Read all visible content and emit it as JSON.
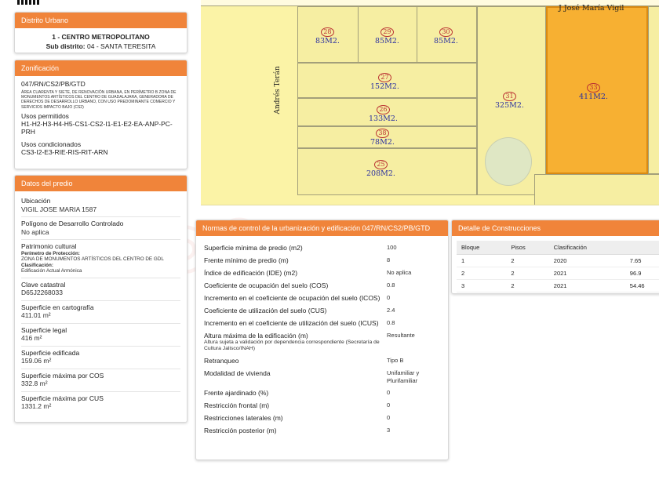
{
  "distrito": {
    "header": "Distrito Urbano",
    "name": "1 - CENTRO METROPOLITANO",
    "sub_label": "Sub distrito:",
    "sub_value": "04 - SANTA TERESITA"
  },
  "zonificacion": {
    "header": "Zonificación",
    "code": "047/RN/CS2/PB/GTD",
    "description": "ÁREA CUARENTA Y SIETE, DE RENOVACIÓN URBANA, EN PERÍMETRO B ZONA DE MONUMENTOS ARTÍSTICOS DEL CENTRO DE GUADALAJARA, GENERADORA DE DERECHOS DE DESARROLLO URBANO, CON USO PREDOMINANTE COMERCIO Y SERVICIOS IMPACTO BAJO (CS2)",
    "usos_permitidos_label": "Usos permitidos",
    "usos_permitidos": "H1-H2-H3-H4-H5-CS1-CS2-I1-E1-E2-EA-ANP-PC-PRH",
    "usos_condicionados_label": "Usos condicionados",
    "usos_condicionados": "CS3-I2-E3-RIE-RIS-RIT-ARN"
  },
  "predio": {
    "header": "Datos del predio",
    "ubicacion_label": "Ubicación",
    "ubicacion": "VIGIL JOSE MARIA 1587",
    "poligono_label": "Polígono de Desarrollo Controlado",
    "poligono": "No aplica",
    "patrimonio_label": "Patrimonio cultural",
    "perimetro_label": "Perímetro de Protección:",
    "perimetro": "ZONA DE MONUMENTOS ARTÍSTICOS DEL CENTRO DE GDL",
    "clasificacion_label": "Clasificación:",
    "clasificacion": "Edificación Actual Armónica",
    "clave_label": "Clave catastral",
    "clave": "D65J2268033",
    "sup_carto_label": "Superficie en cartografía",
    "sup_carto": "411.01 m²",
    "sup_legal_label": "Superficie legal",
    "sup_legal": "416 m²",
    "sup_edif_label": "Superficie edificada",
    "sup_edif": "159.06 m²",
    "sup_cos_label": "Superficie máxima por COS",
    "sup_cos": "332.8 m²",
    "sup_cus_label": "Superficie máxima por CUS",
    "sup_cus": "1331.2 m²"
  },
  "map": {
    "street_1": "J José María Vigil",
    "street_2": "Andrés Terán",
    "lots": [
      {
        "num": "28",
        "area": "83M2."
      },
      {
        "num": "29",
        "area": "85M2."
      },
      {
        "num": "30",
        "area": "85M2."
      },
      {
        "num": "27",
        "area": "152M2."
      },
      {
        "num": "26",
        "area": "133M2."
      },
      {
        "num": "38",
        "area": "78M2."
      },
      {
        "num": "25",
        "area": "208M2."
      },
      {
        "num": "31",
        "area": "325M2."
      },
      {
        "num": "33",
        "area": "411M2."
      }
    ]
  },
  "normas": {
    "header": "Normas de control de la urbanización y edificación 047/RN/CS2/PB/GTD",
    "rows": [
      {
        "label": "Superficie mínima de predio (m2)",
        "value": "100"
      },
      {
        "label": "Frente mínimo de predio (m)",
        "value": "8"
      },
      {
        "label": "Índice de edificación (IDE) (m2)",
        "value": "No aplica"
      },
      {
        "label": "Coeficiente de ocupación del suelo (COS)",
        "value": "0.8"
      },
      {
        "label": "Incremento en el coeficiente de ocupación del suelo (ICOS)",
        "value": "0"
      },
      {
        "label": "Coeficiente de utilización del suelo (CUS)",
        "value": "2.4"
      },
      {
        "label": "Incremento en el coeficiente de utilización del suelo (ICUS)",
        "value": "0.8"
      },
      {
        "label": "Altura máxima de la edificación (m)",
        "sub": "Altura sujeta a validación por dependencia correspondiente (Secretaría de Cultura Jalisco/INAH)",
        "value": "Resultante"
      },
      {
        "label": "Retranqueo",
        "value": "Tipo B"
      },
      {
        "label": "Modalidad de vivienda",
        "value": "Unifamiliar y Plurifamiliar"
      },
      {
        "label": "Frente ajardinado (%)",
        "value": "0"
      },
      {
        "label": "Restricción frontal (m)",
        "value": "0"
      },
      {
        "label": "Restricciones laterales (m)",
        "value": "0"
      },
      {
        "label": "Restricción posterior (m)",
        "value": "3"
      }
    ]
  },
  "construcciones": {
    "header": "Detalle de Construcciones",
    "columns": [
      "Bloque",
      "Pisos",
      "Clasificación",
      ""
    ],
    "rows": [
      [
        "1",
        "2",
        "2020",
        "7.65"
      ],
      [
        "2",
        "2",
        "2021",
        "96.9"
      ],
      [
        "3",
        "2",
        "2021",
        "54.46"
      ]
    ]
  },
  "colors": {
    "accent": "#f0843a",
    "map_fill": "#fbf3a6",
    "selected_lot": "#f7b032"
  }
}
